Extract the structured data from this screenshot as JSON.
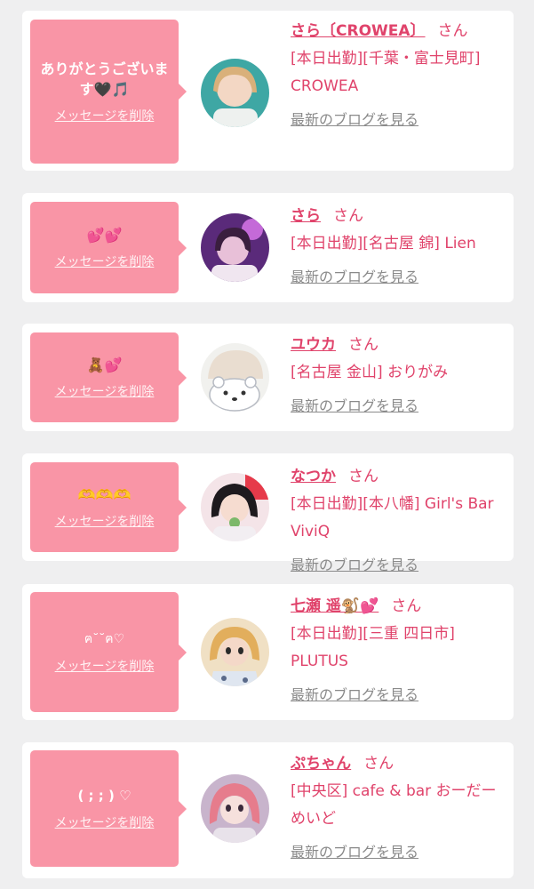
{
  "delete_label": "メッセージを削除",
  "blog_label": "最新のブログを見る",
  "san_label": "さん",
  "cards": [
    {
      "message": "ありがとうございます🖤🎵",
      "name": "さら〔CROWEA〕",
      "detail": "[本日出勤][千葉・富士見町] CROWEA"
    },
    {
      "message": "💕💕",
      "name": "さら",
      "detail": "[本日出勤][名古屋 錦] Lien"
    },
    {
      "message": "🧸💕",
      "name": "ユウカ",
      "detail": "[名古屋 金山] おりがみ"
    },
    {
      "message": "🫶🫶🫶",
      "name": "なつか",
      "detail": "[本日出勤][本八幡] Girl's Bar ViviQ"
    },
    {
      "message": "ฅ˘˘ฅ♡",
      "name": "七瀬 遥🐒💕",
      "detail": "[本日出勤][三重 四日市] PLUTUS"
    },
    {
      "message": "( ; ; ) ♡",
      "name": "ぷちゃん",
      "detail": "[中央区] cafe & bar おーだーめいど"
    }
  ],
  "colors": {
    "background": "#efeff0",
    "bubble": "#f995a6",
    "name_text": "#e0436b",
    "link_gray": "#8a8a8a"
  }
}
